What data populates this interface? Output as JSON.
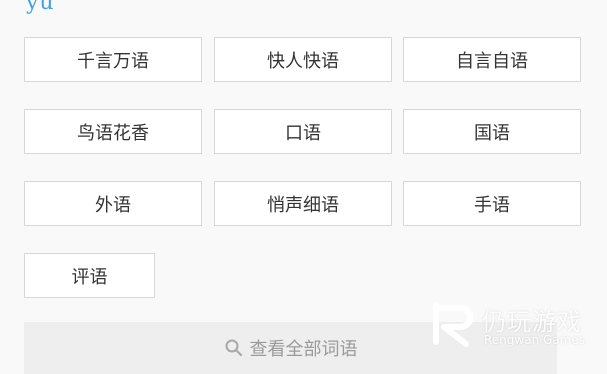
{
  "pinyin": "yu",
  "words": [
    "千言万语",
    "快人快语",
    "自言自语",
    "鸟语花香",
    "口语",
    "国语",
    "外语",
    "悄声细语",
    "手语",
    "评语"
  ],
  "view_all_label": "查看全部词语",
  "watermark": {
    "cn": "仍玩游戏",
    "en": "Rengwan Games"
  },
  "colors": {
    "accent": "#3da0e8",
    "button_border": "#d8d8d8",
    "text": "#333333",
    "muted": "#9a9a9a"
  }
}
